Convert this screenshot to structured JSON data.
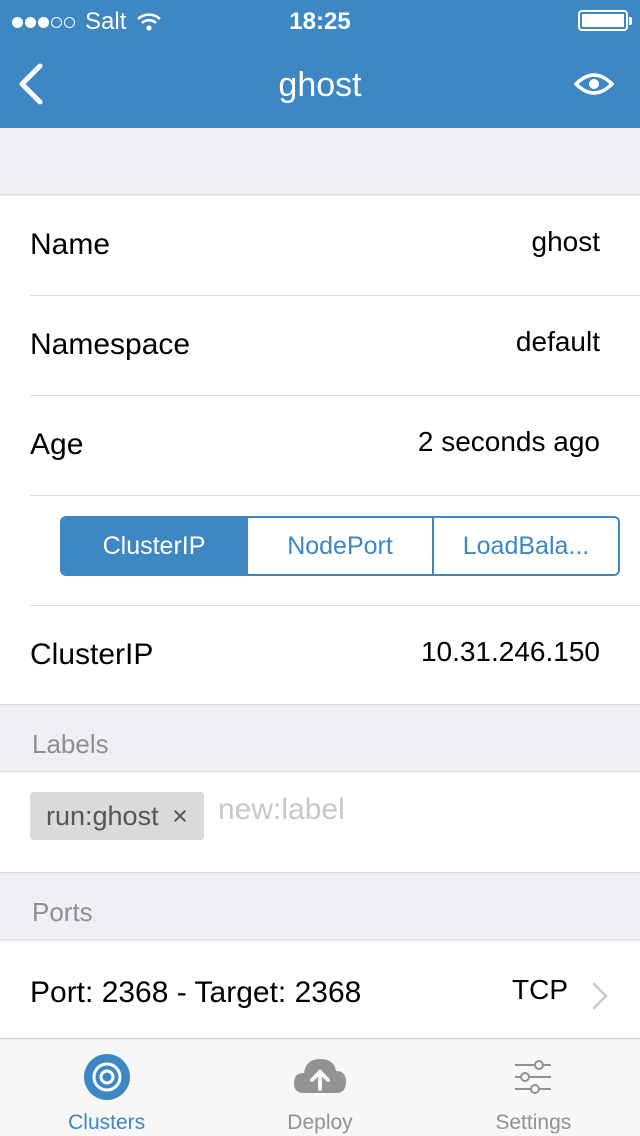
{
  "status_bar": {
    "carrier": "Salt",
    "time": "18:25"
  },
  "nav": {
    "title": "ghost",
    "back_icon": "chevron-left-icon",
    "view_icon": "eye-icon"
  },
  "details": [
    {
      "key": "Name",
      "value": "ghost"
    },
    {
      "key": "Namespace",
      "value": "default"
    },
    {
      "key": "Age",
      "value": "2 seconds ago"
    }
  ],
  "service_type": {
    "options": [
      "ClusterIP",
      "NodePort",
      "LoadBala..."
    ],
    "selected": "ClusterIP"
  },
  "cluster_ip": {
    "key": "ClusterIP",
    "value": "10.31.246.150"
  },
  "labels": {
    "header": "Labels",
    "tags": [
      {
        "text": "run:ghost",
        "remove": "×"
      }
    ],
    "placeholder": "new:label"
  },
  "ports": {
    "header": "Ports",
    "items": [
      {
        "label": "Port: 2368 - Target: 2368",
        "protocol": "TCP"
      }
    ]
  },
  "tabbar": {
    "items": [
      {
        "label": "Clusters",
        "icon": "target-icon",
        "active": true
      },
      {
        "label": "Deploy",
        "icon": "cloud-upload-icon",
        "active": false
      },
      {
        "label": "Settings",
        "icon": "sliders-icon",
        "active": false
      }
    ]
  },
  "colors": {
    "accent": "#3d87c3",
    "background": "#efeff4",
    "inactive": "#929292"
  }
}
